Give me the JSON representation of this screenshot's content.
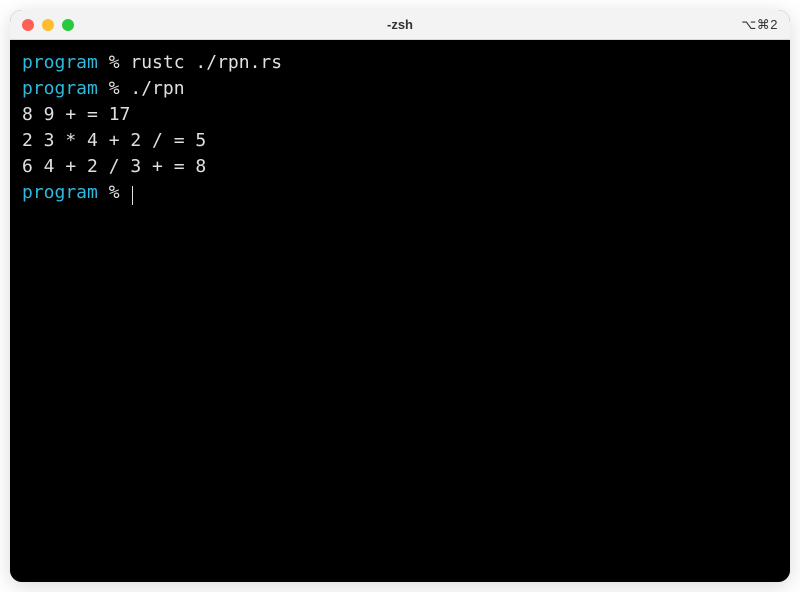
{
  "window": {
    "title": "-zsh",
    "right_indicator": "⌥⌘2"
  },
  "terminal": {
    "prompt": {
      "dir": "program",
      "sep": " % "
    },
    "lines": [
      {
        "type": "prompt",
        "command": "rustc ./rpn.rs"
      },
      {
        "type": "prompt",
        "command": "./rpn"
      },
      {
        "type": "output",
        "text": "8 9 + = 17"
      },
      {
        "type": "output",
        "text": "2 3 * 4 + 2 / = 5"
      },
      {
        "type": "output",
        "text": "6 4 + 2 / 3 + = 8"
      },
      {
        "type": "prompt",
        "command": "",
        "cursor": true
      }
    ]
  }
}
